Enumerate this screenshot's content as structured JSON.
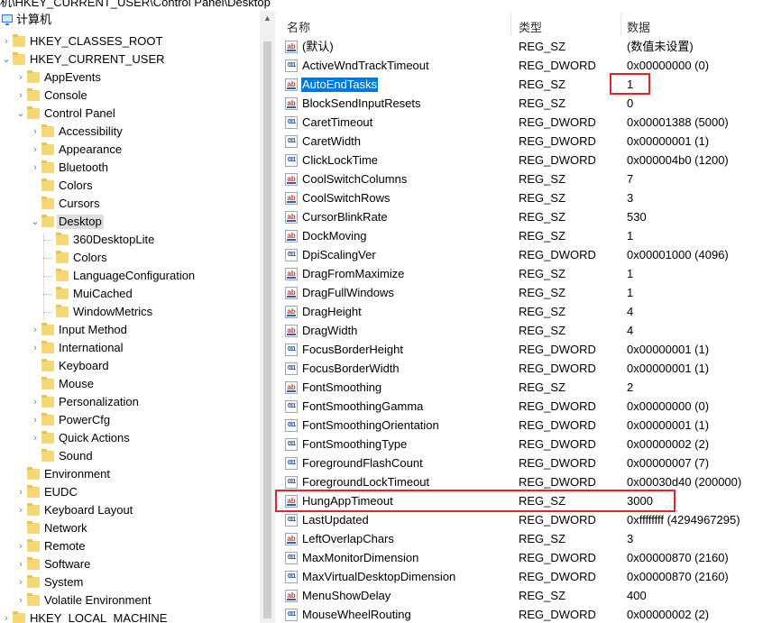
{
  "path": "机\\HKEY_CURRENT_USER\\Control Panel\\Desktop",
  "tree": {
    "root": "计算机",
    "items": [
      {
        "label": "HKEY_CLASSES_ROOT",
        "chevron": "›"
      },
      {
        "label": "HKEY_CURRENT_USER",
        "chevron": "⌄"
      },
      {
        "label": "AppEvents",
        "chevron": "›"
      },
      {
        "label": "Console",
        "chevron": "›"
      },
      {
        "label": "Control Panel",
        "chevron": "⌄"
      },
      {
        "label": "Accessibility",
        "chevron": "›"
      },
      {
        "label": "Appearance",
        "chevron": "›"
      },
      {
        "label": "Bluetooth",
        "chevron": "›"
      },
      {
        "label": "Colors",
        "chevron": ""
      },
      {
        "label": "Cursors",
        "chevron": ""
      },
      {
        "label": "Desktop",
        "chevron": "⌄"
      },
      {
        "label": "360DesktopLite",
        "chevron": ""
      },
      {
        "label": "Colors",
        "chevron": ""
      },
      {
        "label": "LanguageConfiguration",
        "chevron": ""
      },
      {
        "label": "MuiCached",
        "chevron": ""
      },
      {
        "label": "WindowMetrics",
        "chevron": ""
      },
      {
        "label": "Input Method",
        "chevron": "›"
      },
      {
        "label": "International",
        "chevron": "›"
      },
      {
        "label": "Keyboard",
        "chevron": ""
      },
      {
        "label": "Mouse",
        "chevron": ""
      },
      {
        "label": "Personalization",
        "chevron": "›"
      },
      {
        "label": "PowerCfg",
        "chevron": "›"
      },
      {
        "label": "Quick Actions",
        "chevron": "›"
      },
      {
        "label": "Sound",
        "chevron": ""
      },
      {
        "label": "Environment",
        "chevron": ""
      },
      {
        "label": "EUDC",
        "chevron": "›"
      },
      {
        "label": "Keyboard Layout",
        "chevron": "›"
      },
      {
        "label": "Network",
        "chevron": ""
      },
      {
        "label": "Remote",
        "chevron": "›"
      },
      {
        "label": "Software",
        "chevron": "›"
      },
      {
        "label": "System",
        "chevron": "›"
      },
      {
        "label": "Volatile Environment",
        "chevron": "›"
      },
      {
        "label": "HKEY_LOCAL_MACHINE",
        "chevron": "›"
      }
    ]
  },
  "columns": {
    "name": "名称",
    "type": "类型",
    "data": "数据"
  },
  "values": [
    {
      "icon": "ab",
      "name": "(默认)",
      "type": "REG_SZ",
      "data": "(数值未设置)"
    },
    {
      "icon": "011",
      "name": "ActiveWndTrackTimeout",
      "type": "REG_DWORD",
      "data": "0x00000000 (0)"
    },
    {
      "icon": "ab",
      "name": "AutoEndTasks",
      "type": "REG_SZ",
      "data": "1"
    },
    {
      "icon": "ab",
      "name": "BlockSendInputResets",
      "type": "REG_SZ",
      "data": "0"
    },
    {
      "icon": "011",
      "name": "CaretTimeout",
      "type": "REG_DWORD",
      "data": "0x00001388 (5000)"
    },
    {
      "icon": "011",
      "name": "CaretWidth",
      "type": "REG_DWORD",
      "data": "0x00000001 (1)"
    },
    {
      "icon": "011",
      "name": "ClickLockTime",
      "type": "REG_DWORD",
      "data": "0x000004b0 (1200)"
    },
    {
      "icon": "ab",
      "name": "CoolSwitchColumns",
      "type": "REG_SZ",
      "data": "7"
    },
    {
      "icon": "ab",
      "name": "CoolSwitchRows",
      "type": "REG_SZ",
      "data": "3"
    },
    {
      "icon": "ab",
      "name": "CursorBlinkRate",
      "type": "REG_SZ",
      "data": "530"
    },
    {
      "icon": "ab",
      "name": "DockMoving",
      "type": "REG_SZ",
      "data": "1"
    },
    {
      "icon": "011",
      "name": "DpiScalingVer",
      "type": "REG_DWORD",
      "data": "0x00001000 (4096)"
    },
    {
      "icon": "ab",
      "name": "DragFromMaximize",
      "type": "REG_SZ",
      "data": "1"
    },
    {
      "icon": "ab",
      "name": "DragFullWindows",
      "type": "REG_SZ",
      "data": "1"
    },
    {
      "icon": "ab",
      "name": "DragHeight",
      "type": "REG_SZ",
      "data": "4"
    },
    {
      "icon": "ab",
      "name": "DragWidth",
      "type": "REG_SZ",
      "data": "4"
    },
    {
      "icon": "011",
      "name": "FocusBorderHeight",
      "type": "REG_DWORD",
      "data": "0x00000001 (1)"
    },
    {
      "icon": "011",
      "name": "FocusBorderWidth",
      "type": "REG_DWORD",
      "data": "0x00000001 (1)"
    },
    {
      "icon": "ab",
      "name": "FontSmoothing",
      "type": "REG_SZ",
      "data": "2"
    },
    {
      "icon": "011",
      "name": "FontSmoothingGamma",
      "type": "REG_DWORD",
      "data": "0x00000000 (0)"
    },
    {
      "icon": "011",
      "name": "FontSmoothingOrientation",
      "type": "REG_DWORD",
      "data": "0x00000001 (1)"
    },
    {
      "icon": "011",
      "name": "FontSmoothingType",
      "type": "REG_DWORD",
      "data": "0x00000002 (2)"
    },
    {
      "icon": "011",
      "name": "ForegroundFlashCount",
      "type": "REG_DWORD",
      "data": "0x00000007 (7)"
    },
    {
      "icon": "011",
      "name": "ForegroundLockTimeout",
      "type": "REG_DWORD",
      "data": "0x00030d40 (200000)"
    },
    {
      "icon": "ab",
      "name": "HungAppTimeout",
      "type": "REG_SZ",
      "data": "3000"
    },
    {
      "icon": "011",
      "name": "LastUpdated",
      "type": "REG_DWORD",
      "data": "0xffffffff (4294967295)"
    },
    {
      "icon": "ab",
      "name": "LeftOverlapChars",
      "type": "REG_SZ",
      "data": "3"
    },
    {
      "icon": "011",
      "name": "MaxMonitorDimension",
      "type": "REG_DWORD",
      "data": "0x00000870 (2160)"
    },
    {
      "icon": "011",
      "name": "MaxVirtualDesktopDimension",
      "type": "REG_DWORD",
      "data": "0x00000870 (2160)"
    },
    {
      "icon": "ab",
      "name": "MenuShowDelay",
      "type": "REG_SZ",
      "data": "400"
    },
    {
      "icon": "011",
      "name": "MouseWheelRouting",
      "type": "REG_DWORD",
      "data": "0x00000002 (2)"
    }
  ],
  "selected_value": "AutoEndTasks",
  "selected_key": "Desktop",
  "highlight_color": "#e0262a",
  "selection_color": "#0078d7"
}
